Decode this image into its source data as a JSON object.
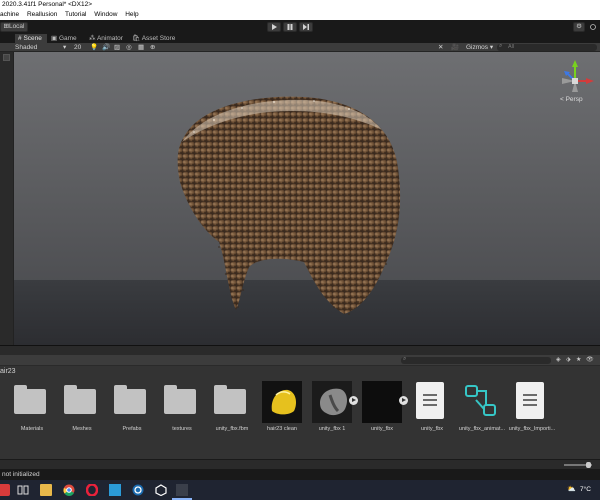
{
  "window": {
    "title": "2020.3.41f1 Personal* <DX12>"
  },
  "menu": [
    "achine",
    "Reallusion",
    "Tutorial",
    "Window",
    "Help"
  ],
  "toolbar": {
    "local_label": "Local"
  },
  "tabs": [
    {
      "label": "Scene",
      "active": true
    },
    {
      "label": "Game",
      "active": false
    },
    {
      "label": "Animator",
      "active": false
    },
    {
      "label": "Asset Store",
      "active": false
    }
  ],
  "scene_toolbar": {
    "shading_mode": "Shaded",
    "zoom_value": "20",
    "gizmos_label": "Gizmos",
    "search_placeholder": "All"
  },
  "viewport": {
    "projection_label": "< Persp"
  },
  "project": {
    "path": "air23",
    "assets": [
      {
        "name": "Materials",
        "type": "folder"
      },
      {
        "name": "Meshes",
        "type": "folder"
      },
      {
        "name": "Prefabs",
        "type": "folder"
      },
      {
        "name": "textures",
        "type": "folder"
      },
      {
        "name": "unity_fbx.fbm",
        "type": "folder"
      },
      {
        "name": "hair23 clean",
        "type": "material-yellow"
      },
      {
        "name": "unity_fbx 1",
        "type": "model"
      },
      {
        "name": "unity_fbx",
        "type": "model-dark"
      },
      {
        "name": "unity_fbx",
        "type": "doc"
      },
      {
        "name": "unity_fbx_animat...",
        "type": "anim-controller"
      },
      {
        "name": "unity_fbx_Importi...",
        "type": "doc"
      }
    ],
    "badge_count": "10"
  },
  "status": {
    "text": "not initialized"
  },
  "taskbar": {
    "temperature": "7°C"
  },
  "colors": {
    "editor_bg": "#191919",
    "panel_bg": "#333333",
    "accent_cyan": "#36c6c6",
    "gizmo_green": "#78d21e",
    "gizmo_red": "#d23c3c",
    "gizmo_blue": "#3c78e6"
  }
}
